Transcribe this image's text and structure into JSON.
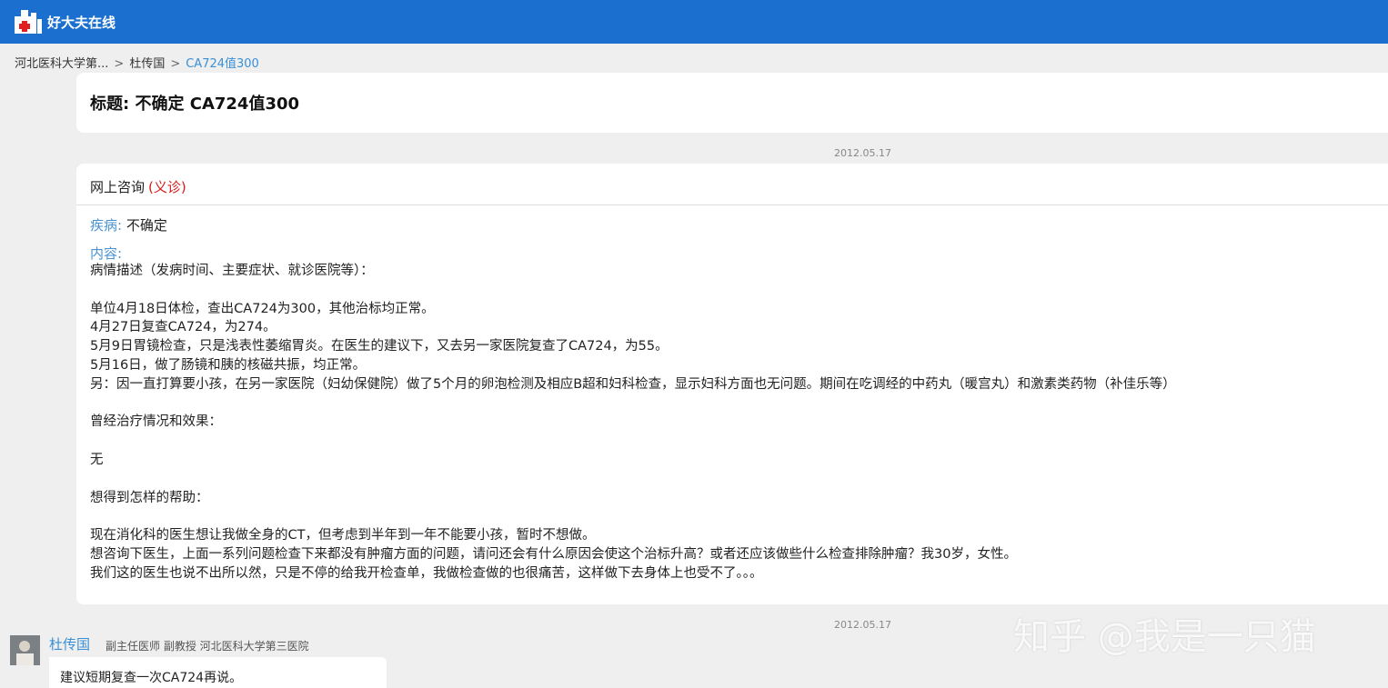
{
  "header": {
    "logo_text": "好大夫在线",
    "brand_color": "#1a6fcf"
  },
  "breadcrumb": {
    "items": [
      "河北医科大学第...",
      "杜传国"
    ],
    "current": "CA724值300",
    "separator": ">"
  },
  "title": {
    "text": "标题: 不确定 CA724值300"
  },
  "consultation": {
    "date": "2012.05.17",
    "type": "网上咨询",
    "type_tag": "(义诊)",
    "disease_label": "疾病:",
    "disease_value": "不确定",
    "content_label": "内容:",
    "content": "病情描述（发病时间、主要症状、就诊医院等）：\n\n单位4月18日体检，查出CA724为300，其他治标均正常。\n4月27日复查CA724，为274。\n5月9日胃镜检查，只是浅表性萎缩胃炎。在医生的建议下，又去另一家医院复查了CA724，为55。\n5月16日，做了肠镜和胰的核磁共振，均正常。\n另：因一直打算要小孩，在另一家医院（妇幼保健院）做了5个月的卵泡检测及相应B超和妇科检查，显示妇科方面也无问题。期间在吃调经的中药丸（暖宫丸）和激素类药物（补佳乐等）\n\n曾经治疗情况和效果：\n\n无\n\n想得到怎样的帮助：\n\n现在消化科的医生想让我做全身的CT，但考虑到半年到一年不能要小孩，暂时不想做。\n想咨询下医生，上面一系列问题检查下来都没有肿瘤方面的问题，请问还会有什么原因会使这个治标升高？或者还应该做些什么检查排除肿瘤？我30岁，女性。\n我们这的医生也说不出所以然，只是不停的给我开检查单，我做检查做的也很痛苦，这样做下去身体上也受不了。。。"
  },
  "reply": {
    "date": "2012.05.17",
    "doctor_name": "杜传国",
    "doctor_title": "副主任医师 副教授 河北医科大学第三医院",
    "text": "建议短期复查一次CA724再说。"
  },
  "watermark": {
    "text": "知乎 @我是一只猫"
  }
}
